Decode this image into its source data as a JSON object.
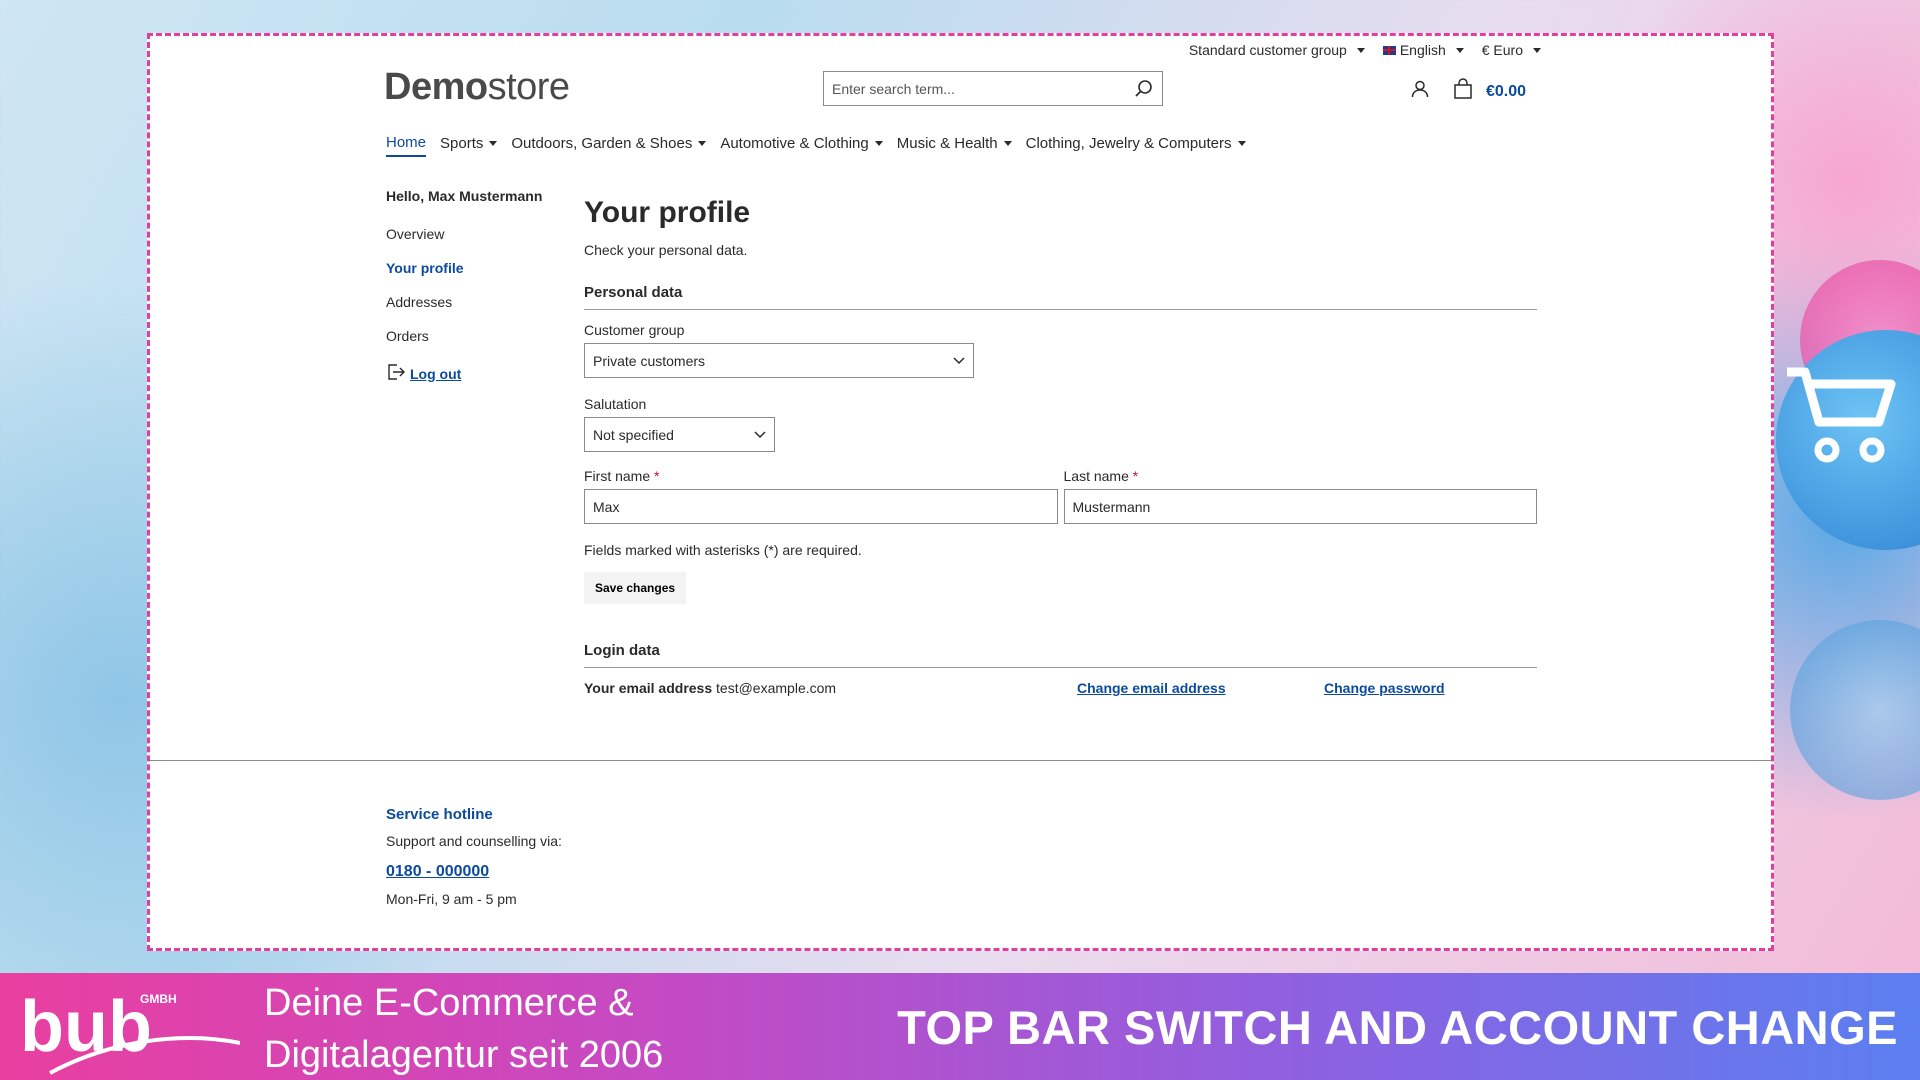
{
  "topbar": {
    "customer_group": "Standard customer group",
    "language": "English",
    "currency": "€ Euro"
  },
  "header": {
    "logo_bold": "Demo",
    "logo_light": "store",
    "search_placeholder": "Enter search term...",
    "cart_total": "€0.00"
  },
  "nav": {
    "items": [
      {
        "label": "Home"
      },
      {
        "label": "Sports"
      },
      {
        "label": "Outdoors, Garden & Shoes"
      },
      {
        "label": "Automotive & Clothing"
      },
      {
        "label": "Music & Health"
      },
      {
        "label": "Clothing, Jewelry & Computers"
      }
    ]
  },
  "sidebar": {
    "greeting": "Hello, Max Mustermann",
    "links": [
      {
        "label": "Overview"
      },
      {
        "label": "Your profile"
      },
      {
        "label": "Addresses"
      },
      {
        "label": "Orders"
      }
    ],
    "logout": "Log out"
  },
  "profile": {
    "title": "Your profile",
    "subtitle": "Check your personal data.",
    "personal_title": "Personal data",
    "customer_group_label": "Customer group",
    "customer_group_value": "Private customers",
    "salutation_label": "Salutation",
    "salutation_value": "Not specified",
    "first_name_label": "First name",
    "first_name_value": "Max",
    "last_name_label": "Last name",
    "last_name_value": "Mustermann",
    "required_mark": "*",
    "required_note": "Fields marked with asterisks (*) are required.",
    "save_label": "Save changes",
    "login_title": "Login data",
    "email_label": "Your email address",
    "email_value": "test@example.com",
    "change_email": "Change email address",
    "change_password": "Change password"
  },
  "footer": {
    "title": "Service hotline",
    "text": "Support and counselling via:",
    "phone": "0180 - 000000",
    "hours": "Mon-Fri, 9 am - 5 pm"
  },
  "banner": {
    "logo_text": "bub",
    "logo_sub": "GMBH",
    "tagline_1": "Deine E-Commerce &",
    "tagline_2": "Digitalagentur seit 2006",
    "headline": "TOP BAR SWITCH AND ACCOUNT CHANGE"
  },
  "colors": {
    "accent": "#0b4a9c",
    "frame": "#e13ea0",
    "required": "#c8102e"
  }
}
